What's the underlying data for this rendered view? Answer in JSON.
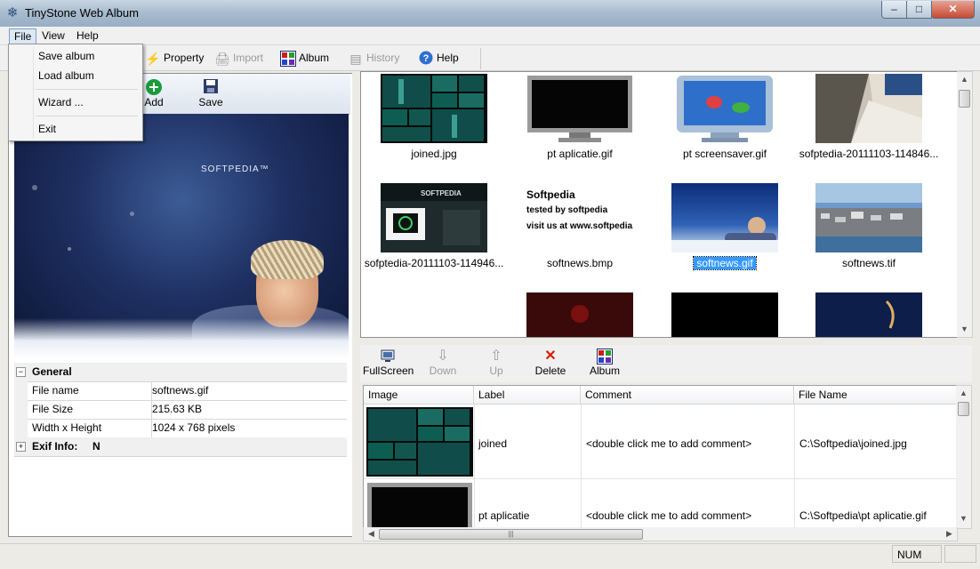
{
  "window": {
    "title": "TinyStone Web Album",
    "controls": {
      "minimize": "–",
      "maximize": "□",
      "close": "✕"
    }
  },
  "menubar": {
    "items": [
      "File",
      "View",
      "Help"
    ]
  },
  "file_menu": {
    "items": [
      "Save album",
      "Load album",
      "Wizard ...",
      "Exit"
    ]
  },
  "toolbar": {
    "items": [
      {
        "label": "Property",
        "icon": "lightning-icon",
        "enabled": true
      },
      {
        "label": "Import",
        "icon": "scanner-icon",
        "enabled": false
      },
      {
        "label": "Album",
        "icon": "album-grid-icon",
        "enabled": true
      },
      {
        "label": "History",
        "icon": "history-icon",
        "enabled": false
      },
      {
        "label": "Help",
        "icon": "help-icon",
        "enabled": true
      }
    ]
  },
  "left_toolbar": {
    "items": [
      {
        "label": "Add",
        "icon": "add-icon"
      },
      {
        "label": "Save",
        "icon": "floppy-icon"
      }
    ]
  },
  "preview": {
    "brand": "SOFTPEDIA™"
  },
  "properties": {
    "general": {
      "title": "General",
      "rows": [
        {
          "name": "File name",
          "value": "softnews.gif"
        },
        {
          "name": "File Size",
          "value": "215.63 KB"
        },
        {
          "name": "Width x Height",
          "value": "1024 x 768 pixels"
        }
      ]
    },
    "exif": {
      "title": "Exif Info:",
      "value": "N"
    }
  },
  "thumbnails": [
    {
      "label": "joined.jpg",
      "selected": false
    },
    {
      "label": "pt aplicatie.gif",
      "selected": false
    },
    {
      "label": "pt screensaver.gif",
      "selected": false
    },
    {
      "label": "sofptedia-20111103-114846...",
      "selected": false
    },
    {
      "label": "sofptedia-20111103-114946...",
      "selected": false
    },
    {
      "label": "softnews.bmp",
      "selected": false
    },
    {
      "label": "softnews.gif",
      "selected": true
    },
    {
      "label": "softnews.tif",
      "selected": false
    }
  ],
  "softnews_bmp_text": [
    "Softpedia",
    "tested by softpedia",
    "visit us at www.softpedia.com"
  ],
  "lower_toolbar": {
    "items": [
      {
        "label": "FullScreen",
        "icon": "monitor-icon",
        "enabled": true
      },
      {
        "label": "Down",
        "icon": "arrow-down-icon",
        "enabled": false
      },
      {
        "label": "Up",
        "icon": "arrow-up-icon",
        "enabled": false
      },
      {
        "label": "Delete",
        "icon": "delete-x-icon",
        "enabled": true
      },
      {
        "label": "Album",
        "icon": "album-grid-icon",
        "enabled": true
      }
    ]
  },
  "table": {
    "columns": [
      "Image",
      "Label",
      "Comment",
      "File Name"
    ],
    "rows": [
      {
        "label": "joined",
        "comment": "<double click me to add comment>",
        "file": "C:\\Softpedia\\joined.jpg"
      },
      {
        "label": "pt aplicatie",
        "comment": "<double click me to add comment>",
        "file": "C:\\Softpedia\\pt aplicatie.gif"
      }
    ]
  },
  "statusbar": {
    "num": "NUM"
  },
  "colors": {
    "selection": "#3399ff",
    "delete": "#d81e05",
    "add": "#1a9b3a"
  }
}
